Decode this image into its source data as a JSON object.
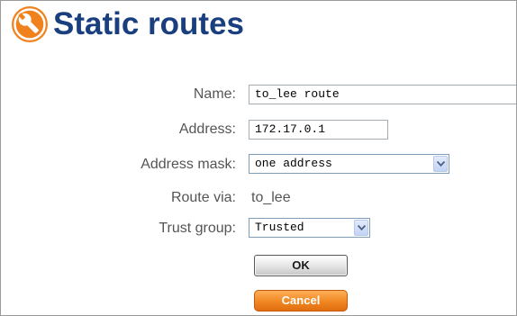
{
  "page": {
    "title": "Static routes",
    "icon": "wrench-icon",
    "accent_color": "#1a3f7e",
    "icon_color": "#f0821e"
  },
  "form": {
    "name": {
      "label": "Name:",
      "value": "to_lee route"
    },
    "address": {
      "label": "Address:",
      "value": "172.17.0.1"
    },
    "address_mask": {
      "label": "Address mask:",
      "selected": "one address"
    },
    "route_via": {
      "label": "Route via:",
      "value": "to_lee"
    },
    "trust_group": {
      "label": "Trust group:",
      "selected": "Trusted"
    }
  },
  "buttons": {
    "ok_label": "OK",
    "cancel_label": "Cancel",
    "cancel_color": "#f28a26"
  }
}
